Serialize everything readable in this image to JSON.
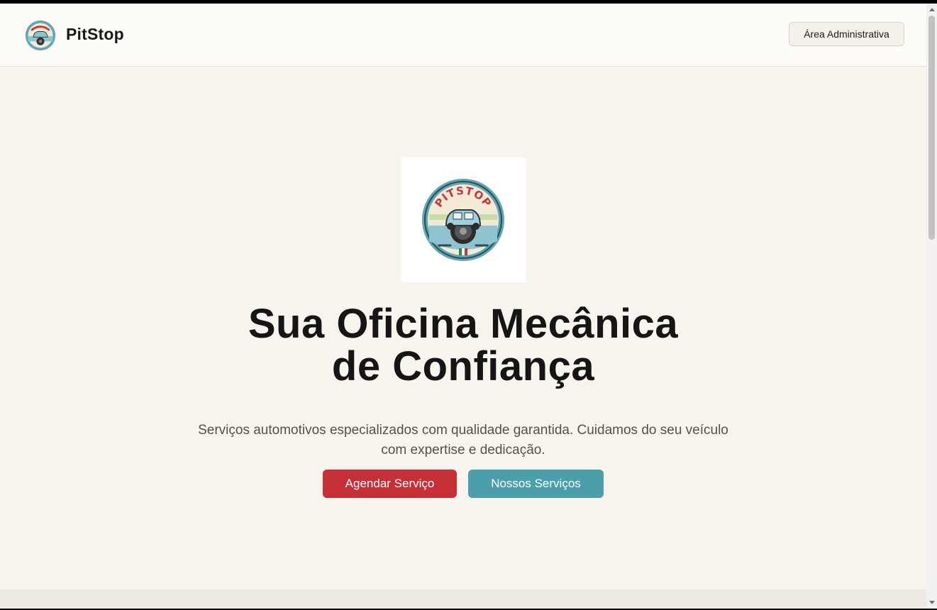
{
  "header": {
    "brand_name": "PitStop",
    "admin_button": "Área Administrativa"
  },
  "logo": {
    "badge_text": "PITSTOP",
    "icon": "car-badge-logo",
    "colors": {
      "ring": "#5fa7b5",
      "text": "#c8353b",
      "car": "#8fc3cf",
      "cream": "#f3ead6"
    }
  },
  "hero": {
    "title_line1": "Sua Oficina Mecânica",
    "title_line2": "de Confiança",
    "subtitle": "Serviços automotivos especializados com qualidade garantida. Cuidamos do seu veículo com expertise e dedicação.",
    "primary_button": "Agendar Serviço",
    "secondary_button": "Nossos Serviços"
  },
  "colors": {
    "background": "#f7f4ee",
    "primary": "#c62f35",
    "secondary": "#4b9fab"
  }
}
